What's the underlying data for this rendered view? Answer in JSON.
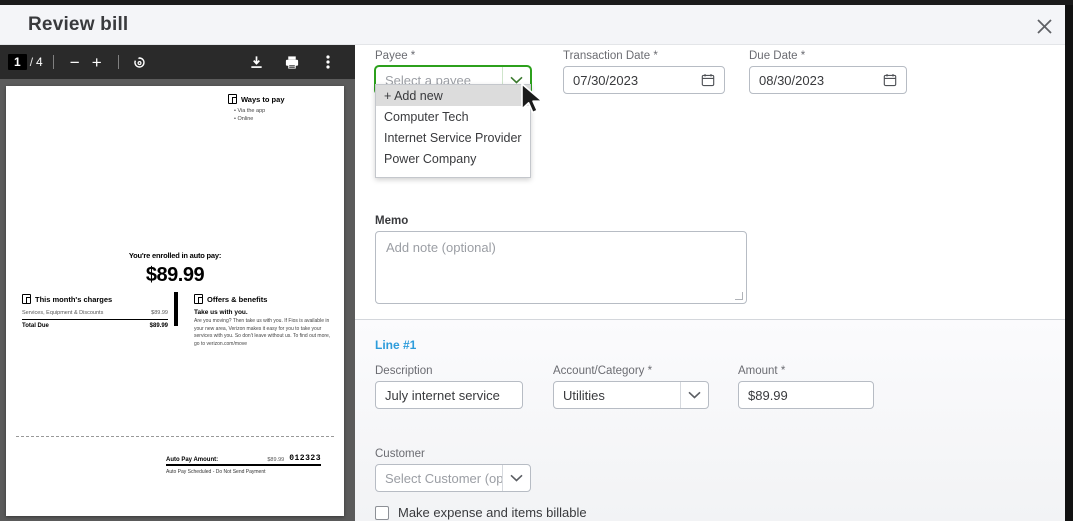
{
  "modal": {
    "title": "Review bill",
    "close_icon": "close-icon"
  },
  "pdf_viewer": {
    "current_page": "1",
    "page_separator": "/",
    "total_pages": "4",
    "zoom_out_label": "−",
    "zoom_in_label": "+",
    "rotate_icon": "rotate-icon",
    "download_icon": "download-icon",
    "print_icon": "print-icon",
    "more_icon": "more-options-icon",
    "document": {
      "ways_to_pay": {
        "heading": "Ways to pay",
        "items": [
          "Via the app",
          "Online"
        ]
      },
      "autopay": {
        "label": "You're enrolled in auto pay:",
        "amount": "$89.99"
      },
      "charges": {
        "heading": "This month's charges",
        "row_label": "Services, Equipment & Discounts",
        "row_amount": "$89.99",
        "total_label": "Total Due",
        "total_amount": "$89.99"
      },
      "offers": {
        "heading": "Offers & benefits",
        "subheading": "Take us with you.",
        "body": "Are you moving? Then take us with you. If Fios is available in your new area, Verizon makes it easy for you to take your services with you. So don't leave without us. To find out more, go to verizon.com/move"
      },
      "payment_stub": {
        "label": "Auto Pay Amount:",
        "amount": "$89.99",
        "account_number": "012323",
        "note": "Auto Pay Scheduled - Do Not Send Payment"
      }
    }
  },
  "form": {
    "payee": {
      "label": "Payee *",
      "placeholder": "Select a payee",
      "value": "",
      "dropdown_open": true,
      "options": [
        "+ Add new",
        "Computer Tech",
        "Internet Service Provider",
        "Power Company"
      ]
    },
    "transaction_date": {
      "label": "Transaction Date *",
      "value": "07/30/2023",
      "icon": "calendar-icon"
    },
    "due_date": {
      "label": "Due Date *",
      "value": "08/30/2023",
      "icon": "calendar-icon"
    },
    "memo": {
      "label": "Memo",
      "placeholder": "Add note (optional)",
      "value": ""
    },
    "line": {
      "title": "Line #1",
      "description": {
        "label": "Description",
        "value": "July internet service"
      },
      "account_category": {
        "label": "Account/Category *",
        "value": "Utilities"
      },
      "amount": {
        "label": "Amount *",
        "value": "$89.99"
      },
      "customer": {
        "label": "Customer",
        "placeholder": "Select Customer (optional)"
      },
      "billable": {
        "label": "Make expense and items billable",
        "checked": false
      }
    }
  },
  "colors": {
    "accent_green": "#2ca01c",
    "line_link_blue": "#2d9cdb",
    "header_bg": "#f4f5f8",
    "toolbar_bg": "#2a2a2a"
  }
}
